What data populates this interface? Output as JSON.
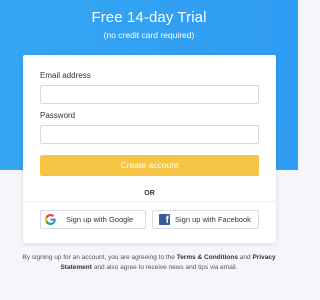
{
  "header": {
    "title": "Free 14-day Trial",
    "subtitle": "(no credit card required)"
  },
  "form": {
    "email_label": "Email address",
    "email_value": "",
    "email_placeholder": "",
    "password_label": "Password",
    "password_value": "",
    "password_placeholder": "",
    "create_label": "Create account",
    "or_label": "OR",
    "google_label": "Sign up with Google",
    "facebook_label": "Sign up with Facebook"
  },
  "icons": {
    "google": "google-icon",
    "facebook": "facebook-icon",
    "facebook_glyph": "f"
  },
  "footer": {
    "part1": "By signing up for an account, you are agreeing to the ",
    "terms_link": "Terms & Conditions",
    "part2": " and ",
    "privacy_link": "Privacy Statement",
    "part3": " and also agree to receive news and tips via email."
  },
  "colors": {
    "hero": "#35a6f1",
    "button": "#f7c545",
    "facebook": "#3b5998"
  }
}
